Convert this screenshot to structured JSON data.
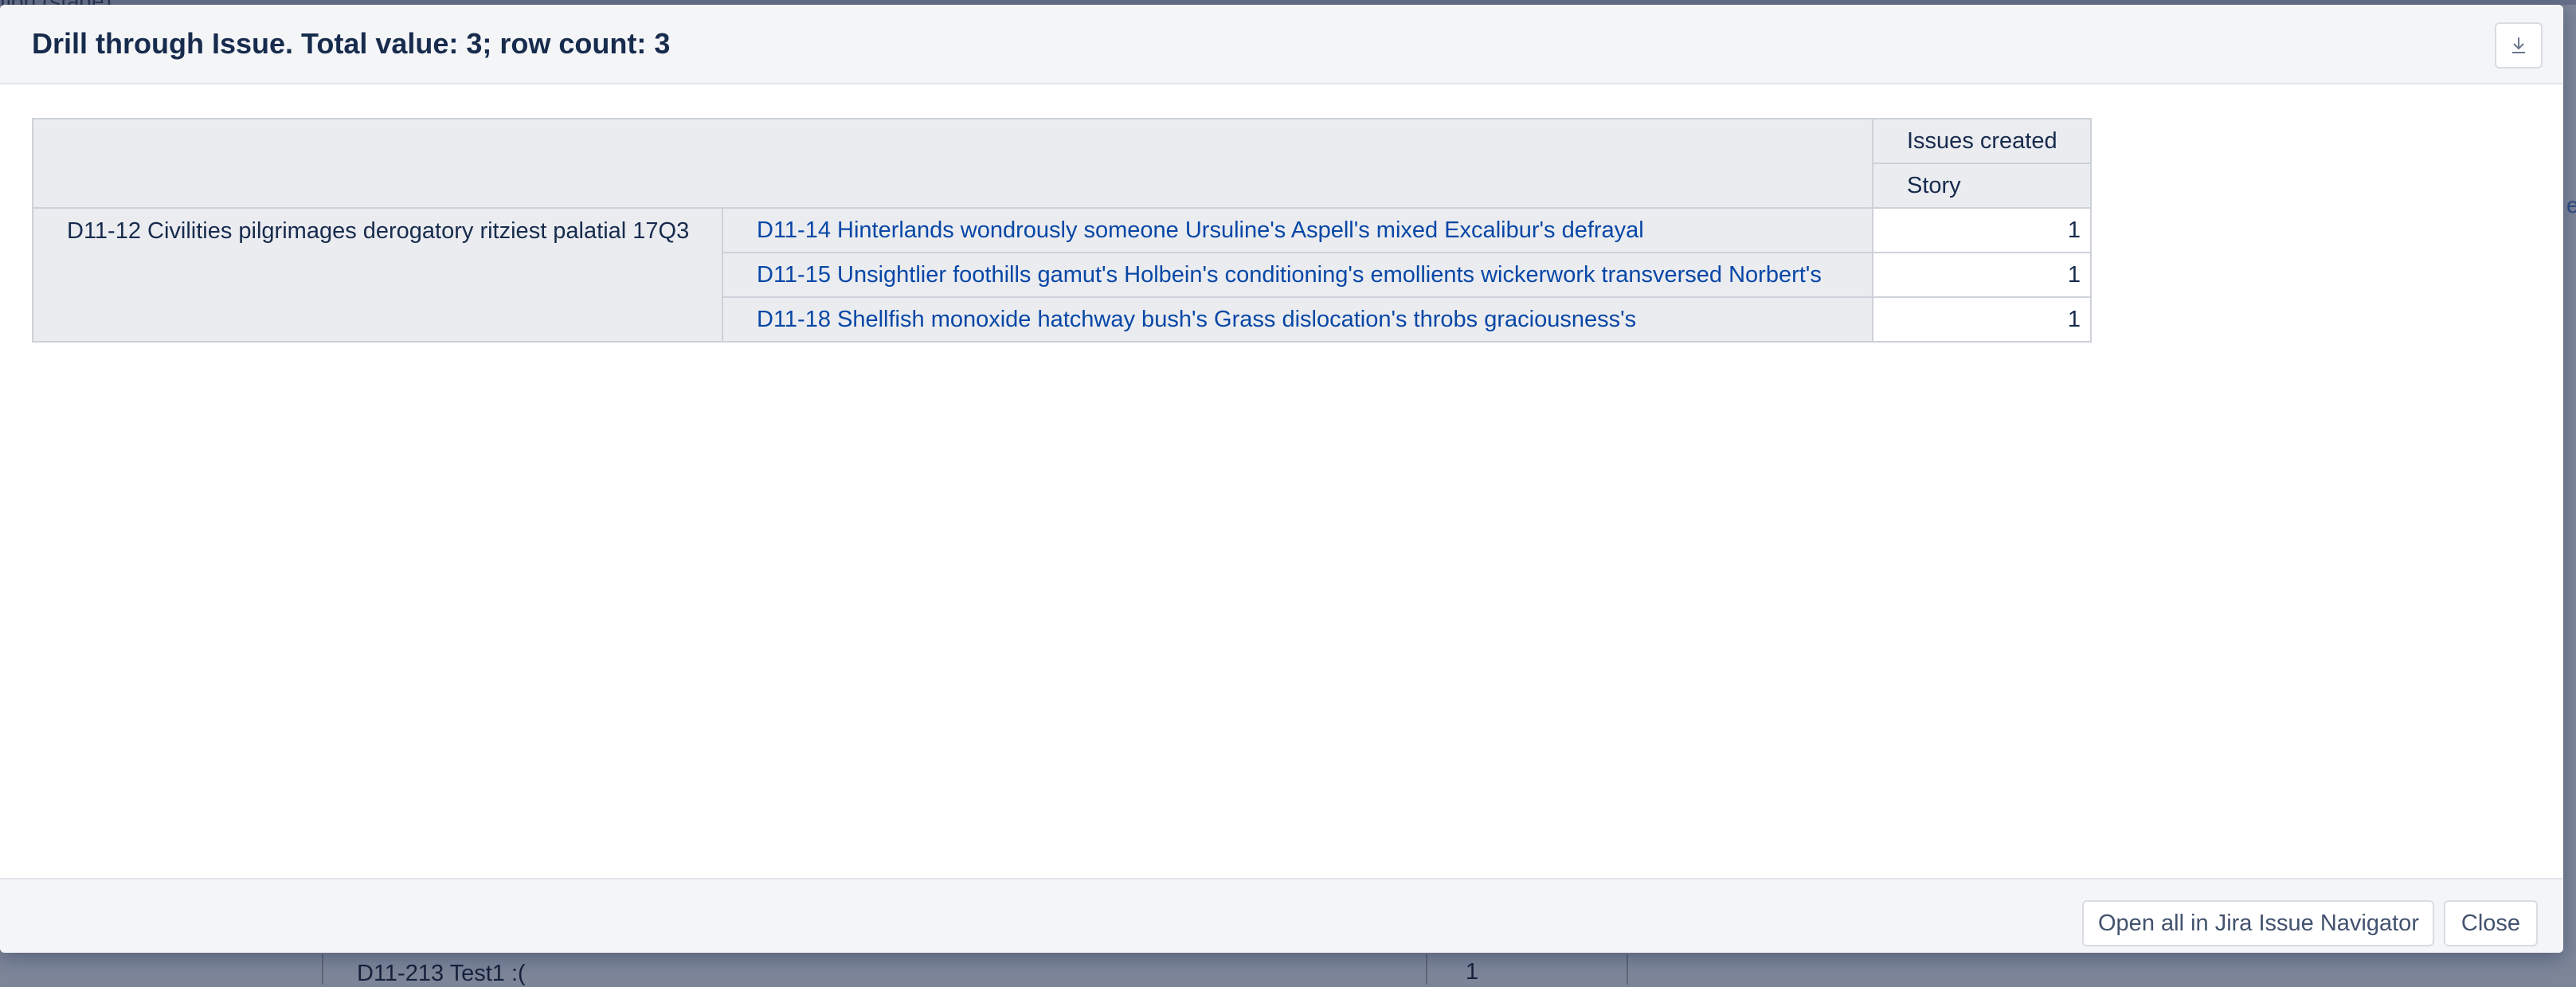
{
  "background": {
    "top_text": "tion (stage)",
    "right_text": "e",
    "row_label": "D11-213 Test1 :(",
    "row_value": "1"
  },
  "modal": {
    "title": "Drill through Issue. Total value: 3; row count: 3",
    "download_icon": "download-icon"
  },
  "table": {
    "measure_header": "Issues created",
    "type_header": "Story",
    "parent_issue": "D11-12 Civilities pilgrimages derogatory ritziest palatial 17Q3",
    "rows": [
      {
        "issue": "D11-14 Hinterlands wondrously someone Ursuline's Aspell's mixed Excalibur's defrayal",
        "value": "1"
      },
      {
        "issue": "D11-15 Unsightlier foothills gamut's Holbein's conditioning's emollients wickerwork transversed Norbert's",
        "value": "1"
      },
      {
        "issue": "D11-18 Shellfish monoxide hatchway bush's Grass dislocation's throbs graciousness's",
        "value": "1"
      }
    ]
  },
  "footer": {
    "open_all_label": "Open all in Jira Issue Navigator",
    "close_label": "Close"
  },
  "colors": {
    "link": "#0747a6",
    "text": "#172b4d",
    "header_bg": "#f4f5f7",
    "cell_bg": "#ebecf0"
  }
}
